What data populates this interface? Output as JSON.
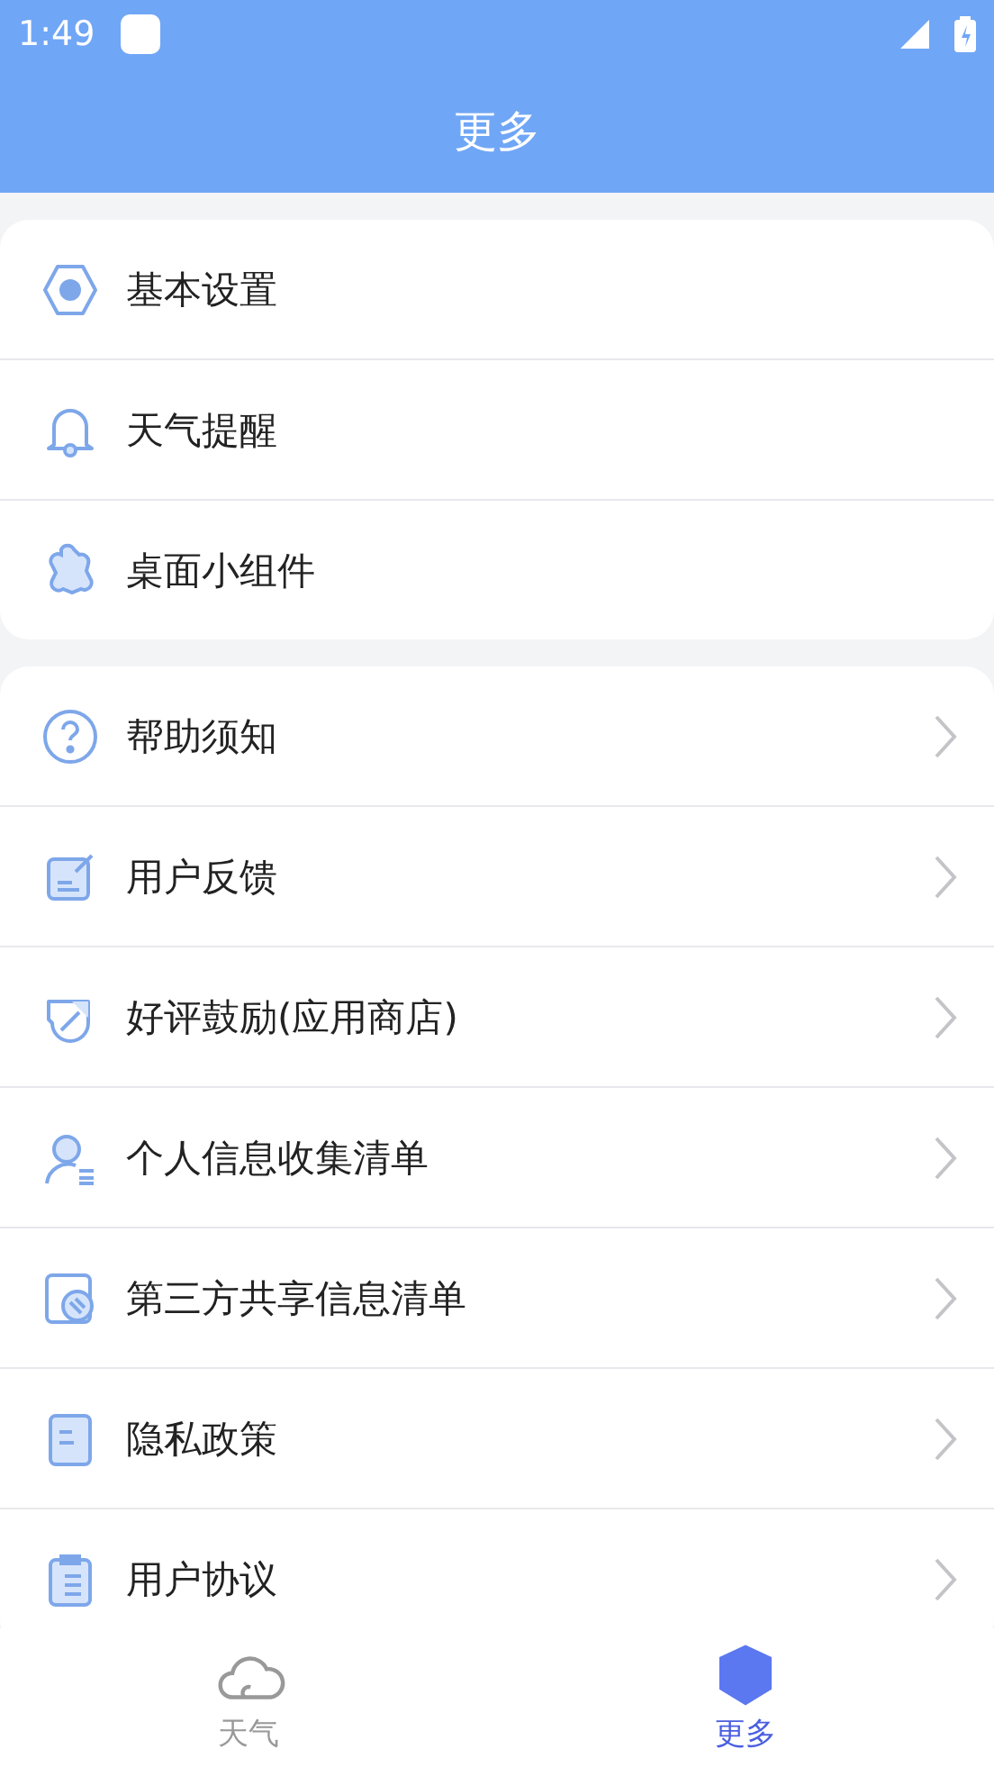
{
  "status_bar": {
    "time": "1:49"
  },
  "header": {
    "title": "更多"
  },
  "groups": [
    {
      "arrows": false,
      "items": [
        {
          "kind": "settings",
          "label": "基本设置"
        },
        {
          "kind": "bell",
          "label": "天气提醒"
        },
        {
          "kind": "widget",
          "label": "桌面小组件"
        }
      ]
    },
    {
      "arrows": true,
      "items": [
        {
          "kind": "help",
          "label": "帮助须知"
        },
        {
          "kind": "feedback",
          "label": "用户反馈"
        },
        {
          "kind": "rate",
          "label": "好评鼓励(应用商店)"
        },
        {
          "kind": "person",
          "label": "个人信息收集清单"
        },
        {
          "kind": "share",
          "label": "第三方共享信息清单"
        },
        {
          "kind": "privacy",
          "label": "隐私政策"
        },
        {
          "kind": "agreement",
          "label": "用户协议"
        }
      ]
    }
  ],
  "tabs": [
    {
      "kind": "weather",
      "label": "天气",
      "selected": false
    },
    {
      "kind": "more",
      "label": "更多",
      "selected": true
    }
  ]
}
